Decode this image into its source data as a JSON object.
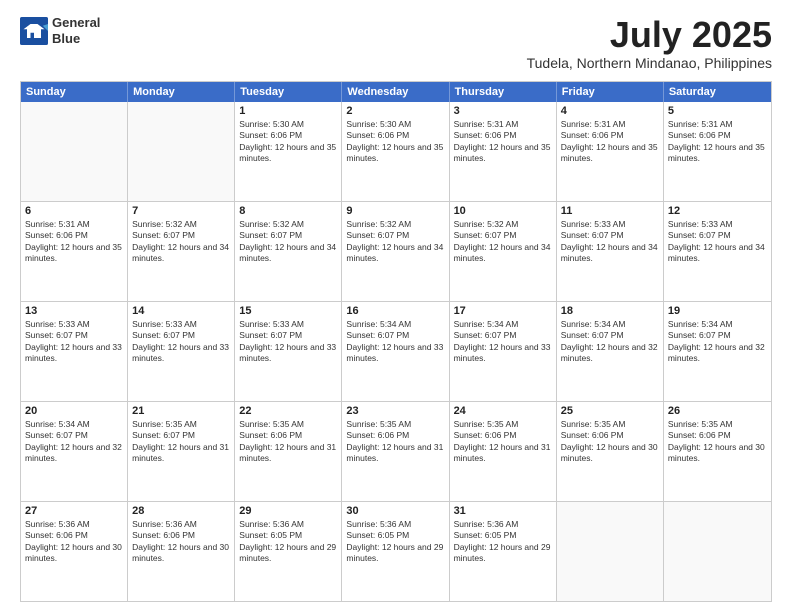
{
  "header": {
    "logo_line1": "General",
    "logo_line2": "Blue",
    "month": "July 2025",
    "location": "Tudela, Northern Mindanao, Philippines"
  },
  "days": [
    "Sunday",
    "Monday",
    "Tuesday",
    "Wednesday",
    "Thursday",
    "Friday",
    "Saturday"
  ],
  "weeks": [
    [
      {
        "day": "",
        "sunrise": "",
        "sunset": "",
        "daylight": ""
      },
      {
        "day": "",
        "sunrise": "",
        "sunset": "",
        "daylight": ""
      },
      {
        "day": "1",
        "sunrise": "Sunrise: 5:30 AM",
        "sunset": "Sunset: 6:06 PM",
        "daylight": "Daylight: 12 hours and 35 minutes."
      },
      {
        "day": "2",
        "sunrise": "Sunrise: 5:30 AM",
        "sunset": "Sunset: 6:06 PM",
        "daylight": "Daylight: 12 hours and 35 minutes."
      },
      {
        "day": "3",
        "sunrise": "Sunrise: 5:31 AM",
        "sunset": "Sunset: 6:06 PM",
        "daylight": "Daylight: 12 hours and 35 minutes."
      },
      {
        "day": "4",
        "sunrise": "Sunrise: 5:31 AM",
        "sunset": "Sunset: 6:06 PM",
        "daylight": "Daylight: 12 hours and 35 minutes."
      },
      {
        "day": "5",
        "sunrise": "Sunrise: 5:31 AM",
        "sunset": "Sunset: 6:06 PM",
        "daylight": "Daylight: 12 hours and 35 minutes."
      }
    ],
    [
      {
        "day": "6",
        "sunrise": "Sunrise: 5:31 AM",
        "sunset": "Sunset: 6:06 PM",
        "daylight": "Daylight: 12 hours and 35 minutes."
      },
      {
        "day": "7",
        "sunrise": "Sunrise: 5:32 AM",
        "sunset": "Sunset: 6:07 PM",
        "daylight": "Daylight: 12 hours and 34 minutes."
      },
      {
        "day": "8",
        "sunrise": "Sunrise: 5:32 AM",
        "sunset": "Sunset: 6:07 PM",
        "daylight": "Daylight: 12 hours and 34 minutes."
      },
      {
        "day": "9",
        "sunrise": "Sunrise: 5:32 AM",
        "sunset": "Sunset: 6:07 PM",
        "daylight": "Daylight: 12 hours and 34 minutes."
      },
      {
        "day": "10",
        "sunrise": "Sunrise: 5:32 AM",
        "sunset": "Sunset: 6:07 PM",
        "daylight": "Daylight: 12 hours and 34 minutes."
      },
      {
        "day": "11",
        "sunrise": "Sunrise: 5:33 AM",
        "sunset": "Sunset: 6:07 PM",
        "daylight": "Daylight: 12 hours and 34 minutes."
      },
      {
        "day": "12",
        "sunrise": "Sunrise: 5:33 AM",
        "sunset": "Sunset: 6:07 PM",
        "daylight": "Daylight: 12 hours and 34 minutes."
      }
    ],
    [
      {
        "day": "13",
        "sunrise": "Sunrise: 5:33 AM",
        "sunset": "Sunset: 6:07 PM",
        "daylight": "Daylight: 12 hours and 33 minutes."
      },
      {
        "day": "14",
        "sunrise": "Sunrise: 5:33 AM",
        "sunset": "Sunset: 6:07 PM",
        "daylight": "Daylight: 12 hours and 33 minutes."
      },
      {
        "day": "15",
        "sunrise": "Sunrise: 5:33 AM",
        "sunset": "Sunset: 6:07 PM",
        "daylight": "Daylight: 12 hours and 33 minutes."
      },
      {
        "day": "16",
        "sunrise": "Sunrise: 5:34 AM",
        "sunset": "Sunset: 6:07 PM",
        "daylight": "Daylight: 12 hours and 33 minutes."
      },
      {
        "day": "17",
        "sunrise": "Sunrise: 5:34 AM",
        "sunset": "Sunset: 6:07 PM",
        "daylight": "Daylight: 12 hours and 33 minutes."
      },
      {
        "day": "18",
        "sunrise": "Sunrise: 5:34 AM",
        "sunset": "Sunset: 6:07 PM",
        "daylight": "Daylight: 12 hours and 32 minutes."
      },
      {
        "day": "19",
        "sunrise": "Sunrise: 5:34 AM",
        "sunset": "Sunset: 6:07 PM",
        "daylight": "Daylight: 12 hours and 32 minutes."
      }
    ],
    [
      {
        "day": "20",
        "sunrise": "Sunrise: 5:34 AM",
        "sunset": "Sunset: 6:07 PM",
        "daylight": "Daylight: 12 hours and 32 minutes."
      },
      {
        "day": "21",
        "sunrise": "Sunrise: 5:35 AM",
        "sunset": "Sunset: 6:07 PM",
        "daylight": "Daylight: 12 hours and 31 minutes."
      },
      {
        "day": "22",
        "sunrise": "Sunrise: 5:35 AM",
        "sunset": "Sunset: 6:06 PM",
        "daylight": "Daylight: 12 hours and 31 minutes."
      },
      {
        "day": "23",
        "sunrise": "Sunrise: 5:35 AM",
        "sunset": "Sunset: 6:06 PM",
        "daylight": "Daylight: 12 hours and 31 minutes."
      },
      {
        "day": "24",
        "sunrise": "Sunrise: 5:35 AM",
        "sunset": "Sunset: 6:06 PM",
        "daylight": "Daylight: 12 hours and 31 minutes."
      },
      {
        "day": "25",
        "sunrise": "Sunrise: 5:35 AM",
        "sunset": "Sunset: 6:06 PM",
        "daylight": "Daylight: 12 hours and 30 minutes."
      },
      {
        "day": "26",
        "sunrise": "Sunrise: 5:35 AM",
        "sunset": "Sunset: 6:06 PM",
        "daylight": "Daylight: 12 hours and 30 minutes."
      }
    ],
    [
      {
        "day": "27",
        "sunrise": "Sunrise: 5:36 AM",
        "sunset": "Sunset: 6:06 PM",
        "daylight": "Daylight: 12 hours and 30 minutes."
      },
      {
        "day": "28",
        "sunrise": "Sunrise: 5:36 AM",
        "sunset": "Sunset: 6:06 PM",
        "daylight": "Daylight: 12 hours and 30 minutes."
      },
      {
        "day": "29",
        "sunrise": "Sunrise: 5:36 AM",
        "sunset": "Sunset: 6:05 PM",
        "daylight": "Daylight: 12 hours and 29 minutes."
      },
      {
        "day": "30",
        "sunrise": "Sunrise: 5:36 AM",
        "sunset": "Sunset: 6:05 PM",
        "daylight": "Daylight: 12 hours and 29 minutes."
      },
      {
        "day": "31",
        "sunrise": "Sunrise: 5:36 AM",
        "sunset": "Sunset: 6:05 PM",
        "daylight": "Daylight: 12 hours and 29 minutes."
      },
      {
        "day": "",
        "sunrise": "",
        "sunset": "",
        "daylight": ""
      },
      {
        "day": "",
        "sunrise": "",
        "sunset": "",
        "daylight": ""
      }
    ]
  ]
}
